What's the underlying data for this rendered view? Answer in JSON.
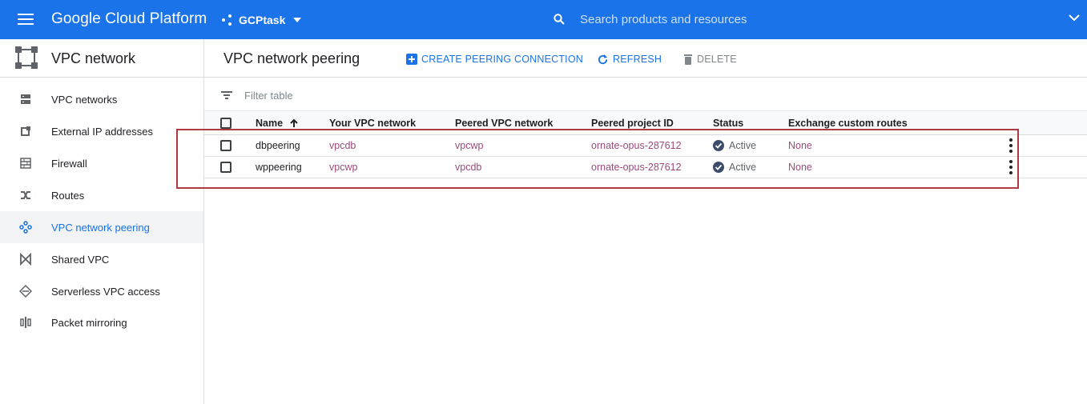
{
  "topbar": {
    "brand": "Google Cloud Platform",
    "project": "GCPtask",
    "search_placeholder": "Search products and resources"
  },
  "sidebar": {
    "title": "VPC network",
    "items": [
      {
        "label": "VPC networks",
        "icon": "vpc-networks-icon",
        "active": false
      },
      {
        "label": "External IP addresses",
        "icon": "external-ip-icon",
        "active": false
      },
      {
        "label": "Firewall",
        "icon": "firewall-icon",
        "active": false
      },
      {
        "label": "Routes",
        "icon": "routes-icon",
        "active": false
      },
      {
        "label": "VPC network peering",
        "icon": "peering-icon",
        "active": true
      },
      {
        "label": "Shared VPC",
        "icon": "shared-vpc-icon",
        "active": false
      },
      {
        "label": "Serverless VPC access",
        "icon": "serverless-icon",
        "active": false
      },
      {
        "label": "Packet mirroring",
        "icon": "packet-mirroring-icon",
        "active": false
      }
    ]
  },
  "header": {
    "title": "VPC network peering",
    "create_label": "CREATE PEERING CONNECTION",
    "refresh_label": "REFRESH",
    "delete_label": "DELETE"
  },
  "filter": {
    "placeholder": "Filter table"
  },
  "table": {
    "columns": [
      "Name",
      "Your VPC network",
      "Peered VPC network",
      "Peered project ID",
      "Status",
      "Exchange custom routes"
    ],
    "sorted_column": "Name",
    "rows": [
      {
        "name": "dbpeering",
        "your_vpc": "vpcdb",
        "peered_vpc": "vpcwp",
        "project_id": "ornate-opus-287612",
        "status": "Active",
        "exchange": "None"
      },
      {
        "name": "wppeering",
        "your_vpc": "vpcwp",
        "peered_vpc": "vpcdb",
        "project_id": "ornate-opus-287612",
        "status": "Active",
        "exchange": "None"
      }
    ]
  },
  "colors": {
    "brand_blue": "#1a73e8",
    "link": "#9c4a7a",
    "status_ok": "#3c4d6b",
    "highlight": "#b03a42"
  }
}
